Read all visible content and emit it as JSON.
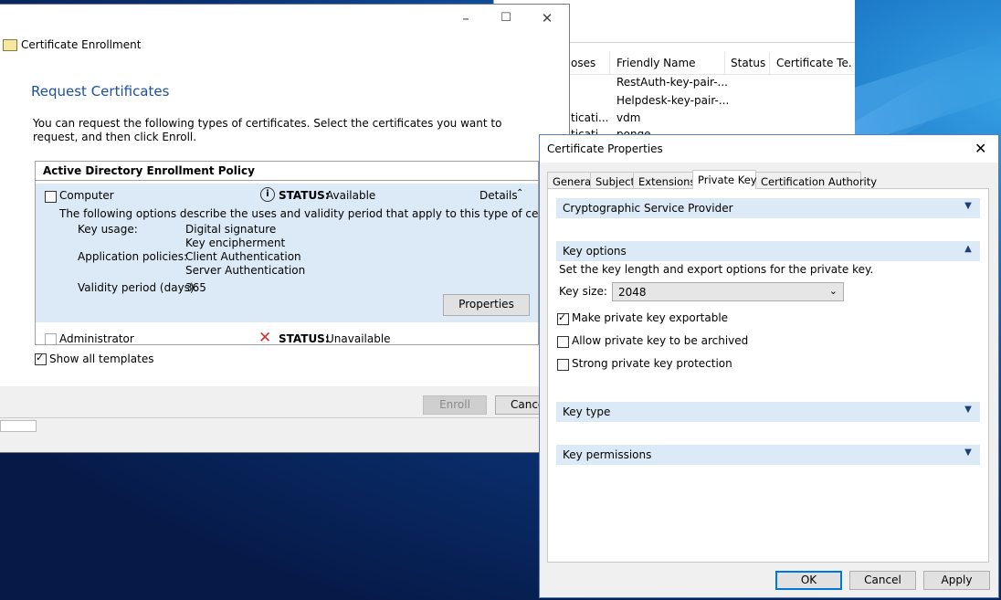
{
  "mmc": {
    "columns": [
      "oses",
      "Friendly Name",
      "Status",
      "Certificate Te..."
    ],
    "rows": [
      {
        "purpose": "",
        "friendly": "RestAuth-key-pair-..."
      },
      {
        "purpose": "",
        "friendly": "Helpdesk-key-pair-..."
      },
      {
        "purpose": "ticati...",
        "friendly": "vdm"
      },
      {
        "purpose": "ticati...",
        "friendly": "ponge"
      }
    ]
  },
  "enroll": {
    "window_title": "Certificate Enrollment",
    "heading": "Request Certificates",
    "description": "You can request the following types of certificates. Select the certificates you want to request, and then click Enroll.",
    "policy_title": "Active Directory Enrollment Policy",
    "computer": {
      "label": "Computer",
      "status_label": "STATUS:",
      "status_value": "Available",
      "details_label": "Details",
      "options_text": "The following options describe the uses and validity period that apply to this type of certificate:",
      "key_usage_label": "Key usage:",
      "key_usage_1": "Digital signature",
      "key_usage_2": "Key encipherment",
      "app_policies_label": "Application policies:",
      "app_policy_1": "Client Authentication",
      "app_policy_2": "Server Authentication",
      "validity_label": "Validity period (days):",
      "validity_value": "365",
      "properties_button": "Properties"
    },
    "administrator": {
      "label": "Administrator",
      "status_label": "STATUS:",
      "status_value": "Unavailable"
    },
    "show_all_templates": "Show all templates",
    "enroll_button": "Enroll",
    "cancel_button": "Cance"
  },
  "props": {
    "title": "Certificate Properties",
    "tabs": [
      "General",
      "Subject",
      "Extensions",
      "Private Key",
      "Certification Authority"
    ],
    "active_tab": "Private Key",
    "csp_section": "Cryptographic Service Provider",
    "key_options_section": "Key options",
    "key_options_desc": "Set the key length and export options for the private key.",
    "key_size_label": "Key size:",
    "key_size_value": "2048",
    "exportable_label": "Make private key exportable",
    "exportable_checked": true,
    "archive_label": "Allow private key to be archived",
    "archive_checked": false,
    "strong_label": "Strong private key protection",
    "strong_checked": false,
    "key_type_section": "Key type",
    "key_permissions_section": "Key permissions",
    "ok_button": "OK",
    "cancel_button": "Cancel",
    "apply_button": "Apply"
  },
  "colors": {
    "accent": "#0078d7",
    "heading_blue": "#1b4f9c",
    "section_bg": "#dbeaf6",
    "unavailable_red": "#d32f2f"
  }
}
